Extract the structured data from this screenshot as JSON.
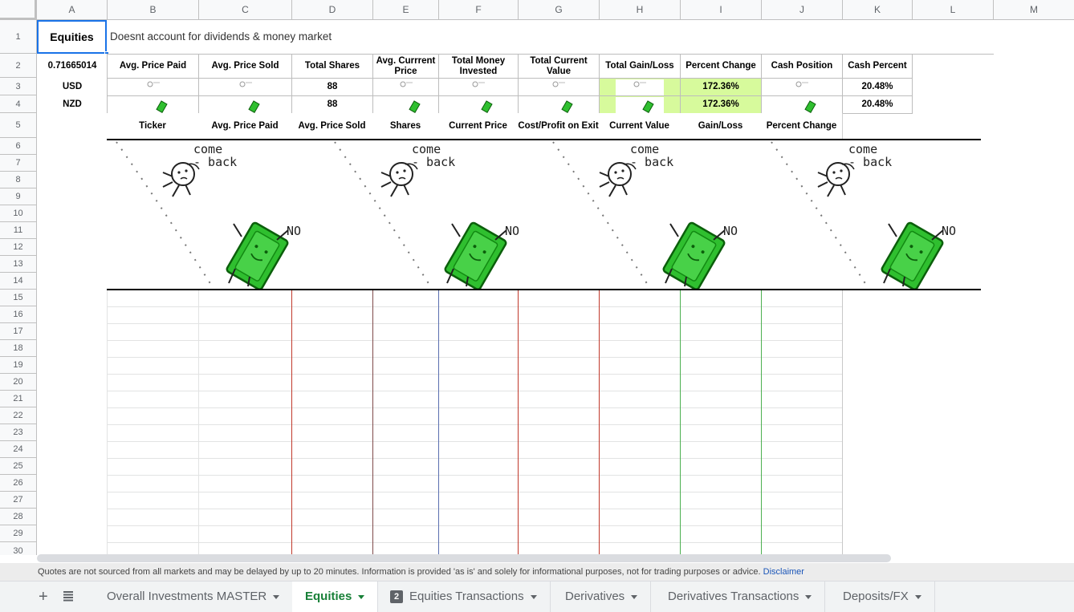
{
  "columns": [
    "A",
    "B",
    "C",
    "D",
    "E",
    "F",
    "G",
    "H",
    "I",
    "J",
    "K",
    "L",
    "M"
  ],
  "rows": [
    "1",
    "2",
    "3",
    "4",
    "5",
    "6",
    "7",
    "8",
    "9",
    "10",
    "11",
    "12",
    "13",
    "14",
    "15",
    "16",
    "17",
    "18",
    "19",
    "20",
    "21",
    "22",
    "23",
    "24",
    "25",
    "26",
    "27",
    "28",
    "29",
    "30"
  ],
  "cells": {
    "a1": "Equities",
    "b1": "Doesnt account for dividends & money market",
    "a2": "0.71665014",
    "a3": "USD",
    "a4": "NZD",
    "header_row2": [
      "Avg. Price Paid",
      "Avg. Price Sold",
      "Total Shares",
      "Avg. Currrent Price",
      "Total Money Invested",
      "Total Current Value",
      "Total Gain/Loss",
      "Percent Change",
      "Cash Position",
      "Cash Percent"
    ],
    "d3": "88",
    "d4": "88",
    "i3": "172.36%",
    "i4": "172.36%",
    "k3": "20.48%",
    "k4": "20.48%",
    "header_row5": [
      "Ticker",
      "Avg. Price Paid",
      "Avg. Price Sold",
      "Shares",
      "Current Price",
      "Cost/Profit on Exit",
      "Current Value",
      "Gain/Loss",
      "Percent Change"
    ]
  },
  "meme": {
    "text_come": "come",
    "text_back": "- back",
    "text_no": "NO",
    "colors": {
      "money": "#2fbf2f",
      "money_dark": "#128a12"
    }
  },
  "colors": {
    "highlight_green": "#d7fa9c",
    "selection_blue": "#1a73e8",
    "tab_green": "#188038"
  },
  "disclaimer": {
    "text": "Quotes are not sourced from all markets and may be delayed by up to 20 minutes. Information is provided 'as is' and solely for informational purposes, not for trading purposes or advice.",
    "link": "Disclaimer"
  },
  "tabs": {
    "add_icon": "plus-icon",
    "list_icon": "list-icon",
    "items": [
      {
        "label": "Overall Investments MASTER"
      },
      {
        "label": "Equities"
      },
      {
        "label": "Equities Transactions",
        "badge": "2"
      },
      {
        "label": "Derivatives"
      },
      {
        "label": "Derivatives Transactions"
      },
      {
        "label": "Deposits/FX"
      }
    ]
  }
}
